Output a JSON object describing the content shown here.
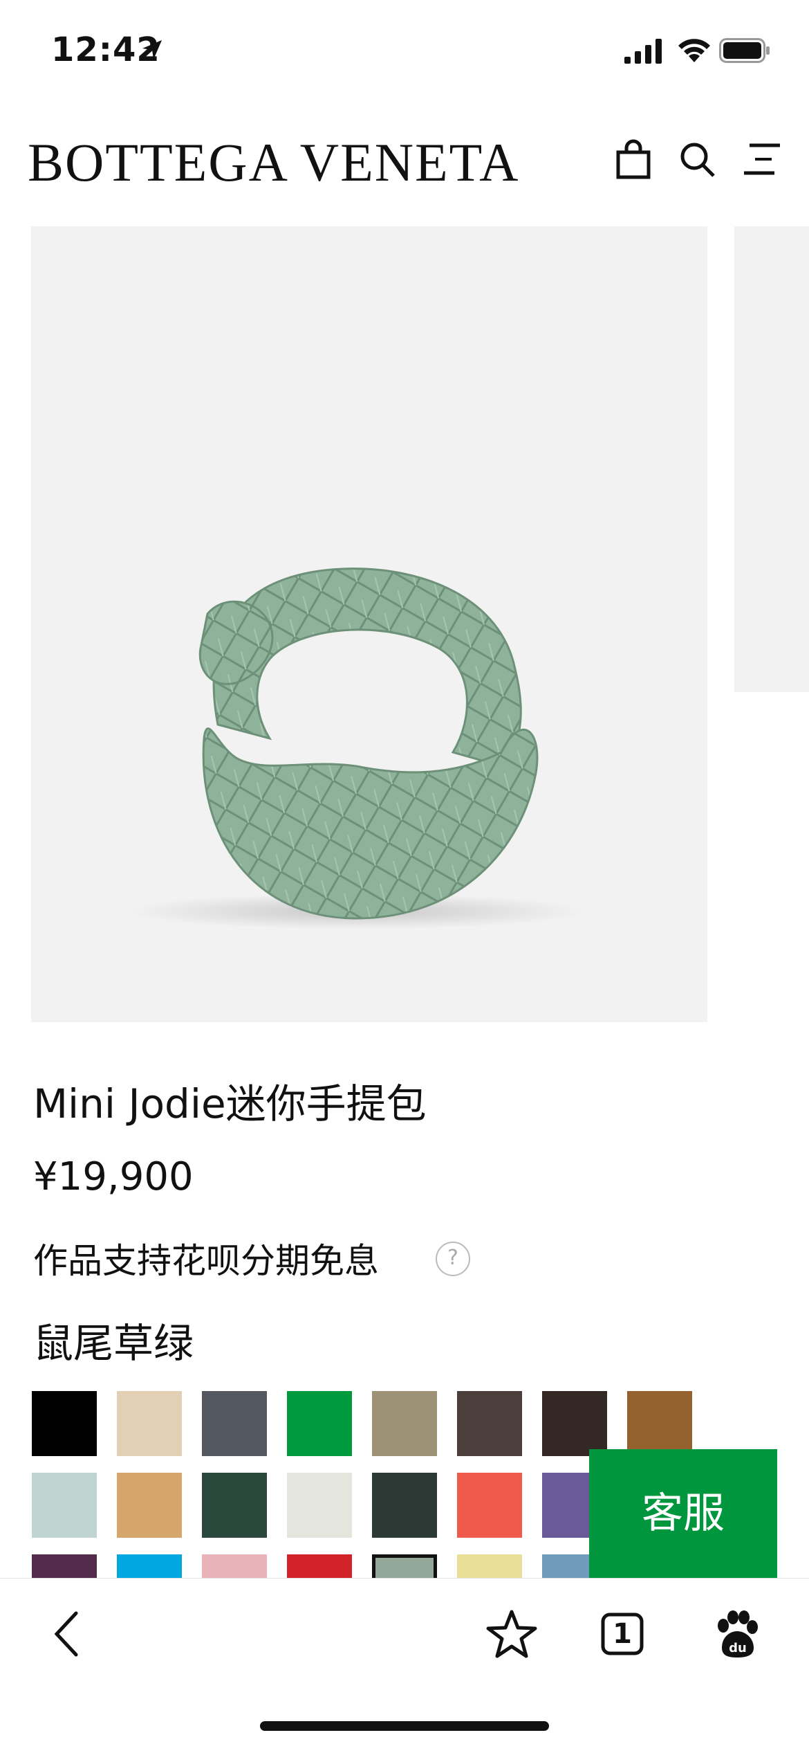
{
  "status_bar": {
    "time": "12:42"
  },
  "header": {
    "brand": "BOTTEGA VENETA",
    "icons": [
      "bag-icon",
      "search-icon",
      "menu-icon"
    ]
  },
  "product": {
    "title": "Mini Jodie迷你手提包",
    "price": "¥19,900",
    "installment": "作品支持花呗分期免息",
    "help": "?",
    "color_name": "鼠尾草绿",
    "image_bg": "#f2f2f2",
    "bag_color": "#8fb39a"
  },
  "swatches": [
    [
      "#000000",
      "#e3cfb3",
      "#525760",
      "#009a3e",
      "#9d9276",
      "#4b3f3b",
      "#332824",
      "#95622f"
    ],
    [
      "#c0d5d2",
      "#d6a56c",
      "#2b483c",
      "#e4e5dd",
      "#2b3a34",
      "#ef5a4d",
      "#6a5a9a"
    ],
    [
      "#542b4a",
      "#00a6e0",
      "#e9b3ba",
      "#d1222a",
      "#93a898",
      "#eadf96",
      "#6f9cba"
    ]
  ],
  "selected_swatch": "#93a898",
  "service_button": {
    "label": "客服",
    "color": "#00963e"
  },
  "toolbar": {
    "tab_count": "1",
    "icons": [
      "back-icon",
      "star-icon",
      "tabs-icon",
      "baidu-paw-icon"
    ]
  }
}
